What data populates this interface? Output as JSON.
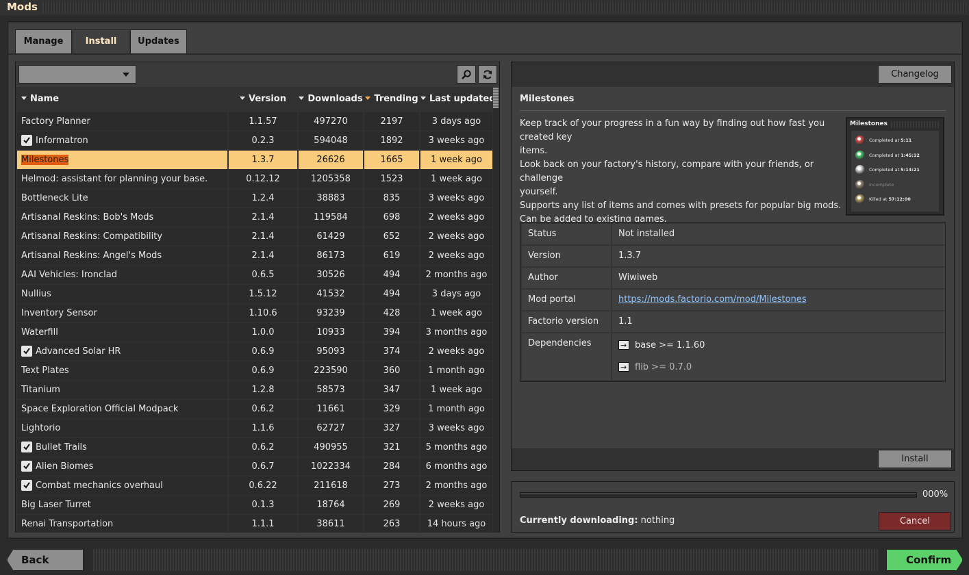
{
  "window": {
    "title": "Mods"
  },
  "tabs": [
    {
      "label": "Manage",
      "active": false
    },
    {
      "label": "Install",
      "active": true
    },
    {
      "label": "Updates",
      "active": false
    }
  ],
  "filter": {
    "selected": ""
  },
  "table": {
    "columns": [
      "Name",
      "Version",
      "Downloads",
      "Trending",
      "Last updated"
    ],
    "sorted_column": "Trending",
    "rows": [
      {
        "name": "Factory Planner",
        "version": "1.1.57",
        "downloads": "497270",
        "trending": "2197",
        "updated": "3 days ago",
        "installed": false,
        "selected": false
      },
      {
        "name": "Informatron",
        "version": "0.2.3",
        "downloads": "594048",
        "trending": "1892",
        "updated": "3 weeks ago",
        "installed": true,
        "selected": false
      },
      {
        "name": "Milestones",
        "version": "1.3.7",
        "downloads": "26626",
        "trending": "1665",
        "updated": "1 week ago",
        "installed": false,
        "selected": true
      },
      {
        "name": "Helmod: assistant for planning your base.",
        "version": "0.12.12",
        "downloads": "1205358",
        "trending": "1523",
        "updated": "1 week ago",
        "installed": false,
        "selected": false
      },
      {
        "name": "Bottleneck Lite",
        "version": "1.2.4",
        "downloads": "38883",
        "trending": "835",
        "updated": "3 weeks ago",
        "installed": false,
        "selected": false
      },
      {
        "name": "Artisanal Reskins: Bob's Mods",
        "version": "2.1.4",
        "downloads": "119584",
        "trending": "698",
        "updated": "2 weeks ago",
        "installed": false,
        "selected": false
      },
      {
        "name": "Artisanal Reskins: Compatibility",
        "version": "2.1.4",
        "downloads": "61429",
        "trending": "652",
        "updated": "2 weeks ago",
        "installed": false,
        "selected": false
      },
      {
        "name": "Artisanal Reskins: Angel's Mods",
        "version": "2.1.4",
        "downloads": "86173",
        "trending": "619",
        "updated": "2 weeks ago",
        "installed": false,
        "selected": false
      },
      {
        "name": "AAI Vehicles: Ironclad",
        "version": "0.6.5",
        "downloads": "30526",
        "trending": "494",
        "updated": "2 months ago",
        "installed": false,
        "selected": false
      },
      {
        "name": "Nullius",
        "version": "1.5.12",
        "downloads": "41532",
        "trending": "494",
        "updated": "3 days ago",
        "installed": false,
        "selected": false
      },
      {
        "name": "Inventory Sensor",
        "version": "1.10.6",
        "downloads": "93239",
        "trending": "428",
        "updated": "1 week ago",
        "installed": false,
        "selected": false
      },
      {
        "name": "Waterfill",
        "version": "1.0.0",
        "downloads": "10933",
        "trending": "394",
        "updated": "3 months ago",
        "installed": false,
        "selected": false
      },
      {
        "name": "Advanced Solar HR",
        "version": "0.6.9",
        "downloads": "95093",
        "trending": "374",
        "updated": "2 weeks ago",
        "installed": true,
        "selected": false
      },
      {
        "name": "Text Plates",
        "version": "0.6.9",
        "downloads": "223590",
        "trending": "360",
        "updated": "1 month ago",
        "installed": false,
        "selected": false
      },
      {
        "name": "Titanium",
        "version": "1.2.8",
        "downloads": "58573",
        "trending": "347",
        "updated": "1 week ago",
        "installed": false,
        "selected": false
      },
      {
        "name": "Space Exploration Official Modpack",
        "version": "0.6.2",
        "downloads": "11661",
        "trending": "329",
        "updated": "1 month ago",
        "installed": false,
        "selected": false
      },
      {
        "name": "Lightorio",
        "version": "1.1.6",
        "downloads": "62727",
        "trending": "327",
        "updated": "3 weeks ago",
        "installed": false,
        "selected": false
      },
      {
        "name": "Bullet Trails",
        "version": "0.6.2",
        "downloads": "490955",
        "trending": "321",
        "updated": "5 months ago",
        "installed": true,
        "selected": false
      },
      {
        "name": "Alien Biomes",
        "version": "0.6.7",
        "downloads": "1022334",
        "trending": "284",
        "updated": "6 months ago",
        "installed": true,
        "selected": false
      },
      {
        "name": "Combat mechanics overhaul",
        "version": "0.6.22",
        "downloads": "211618",
        "trending": "273",
        "updated": "2 months ago",
        "installed": true,
        "selected": false
      },
      {
        "name": "Big Laser Turret",
        "version": "0.1.3",
        "downloads": "18764",
        "trending": "269",
        "updated": "2 weeks ago",
        "installed": false,
        "selected": false
      },
      {
        "name": "Renai Transportation",
        "version": "1.1.1",
        "downloads": "38611",
        "trending": "263",
        "updated": "14 hours ago",
        "installed": false,
        "selected": false
      }
    ]
  },
  "details": {
    "changelog_label": "Changelog",
    "title": "Milestones",
    "description": [
      "Keep track of your progress in a fun way by finding out how fast you created key",
      "items.",
      "Look back on your factory's history, compare with your friends, or challenge",
      "yourself.",
      "Supports any list of items and comes with presets for popular big mods.",
      "Can be added to existing games."
    ],
    "thumbnail": {
      "title": "Milestones",
      "rows": [
        {
          "prefix": "Completed at ",
          "value": "5:11",
          "icon_color": "#d94a4a",
          "dim": false
        },
        {
          "prefix": "Completed at ",
          "value": "1:45:12",
          "icon_color": "#4ad06a",
          "dim": false
        },
        {
          "prefix": "Completed at ",
          "value": "5:14:21",
          "icon_color": "#e0e0e0",
          "dim": false
        },
        {
          "prefix": "Incomplete",
          "value": "",
          "icon_color": "#9a8a70",
          "dim": true
        },
        {
          "prefix": "Killed at ",
          "value": "57:12:00",
          "icon_color": "#b8a060",
          "dim": false
        }
      ]
    },
    "info": {
      "status_key": "Status",
      "status_val": "Not installed",
      "version_key": "Version",
      "version_val": "1.3.7",
      "author_key": "Author",
      "author_val": "Wiwiweb",
      "portal_key": "Mod portal",
      "portal_val": "https://mods.factorio.com/mod/Milestones",
      "factorio_key": "Factorio version",
      "factorio_val": "1.1",
      "deps_key": "Dependencies",
      "deps": [
        "base >= 1.1.60",
        "flib >= 0.7.0"
      ]
    },
    "install_label": "Install"
  },
  "download": {
    "progress_fraction": 0,
    "percent_label": "000%",
    "status_label": "Currently downloading:",
    "status_value": " nothing",
    "cancel_label": "Cancel"
  },
  "footer": {
    "back_label": "Back",
    "confirm_label": "Confirm"
  },
  "colors": {
    "selected_row": "#f8cc7a",
    "highlight": "#e35d10",
    "confirm": "#5cd16a",
    "cancel": "#7a2a2a",
    "link": "#8fc4ff"
  }
}
